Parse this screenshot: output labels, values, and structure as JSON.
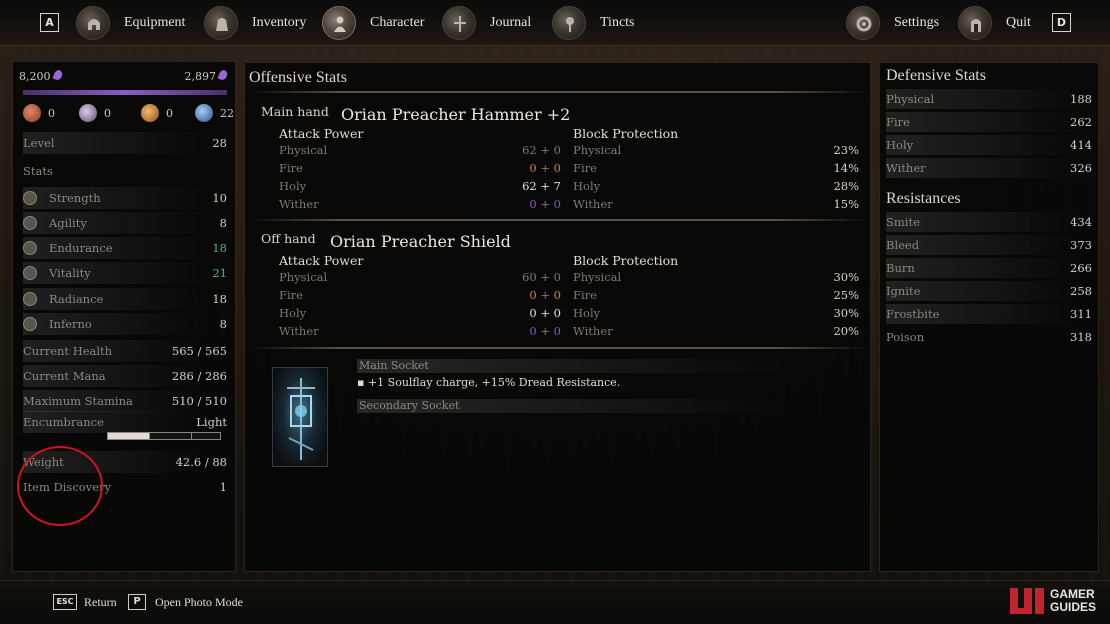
{
  "top_nav": {
    "left_key": "A",
    "right_key": "D",
    "items": [
      {
        "label": "Equipment",
        "icon": "helmet-icon"
      },
      {
        "label": "Inventory",
        "icon": "bag-icon"
      },
      {
        "label": "Character",
        "icon": "character-icon"
      },
      {
        "label": "Journal",
        "icon": "journal-icon"
      },
      {
        "label": "Tincts",
        "icon": "tincts-icon"
      }
    ],
    "settings_label": "Settings",
    "quit_label": "Quit",
    "active": "Character"
  },
  "character": {
    "souls_held": "8,200",
    "souls_needed": "2,897",
    "resources": [
      {
        "icon": "hand-icon",
        "value": "0",
        "color": "#b5533a"
      },
      {
        "icon": "orb-icon",
        "value": "0",
        "color": "#8f7fa6"
      },
      {
        "icon": "amber-icon",
        "value": "0",
        "color": "#b9762f"
      },
      {
        "icon": "crystal-icon",
        "value": "22",
        "color": "#3d6fa8"
      }
    ],
    "level_label": "Level",
    "level_value": "28",
    "stats_heading": "Stats",
    "stats": [
      {
        "label": "Strength",
        "value": "10",
        "highlight": false
      },
      {
        "label": "Agility",
        "value": "8",
        "highlight": false
      },
      {
        "label": "Endurance",
        "value": "18",
        "highlight": true
      },
      {
        "label": "Vitality",
        "value": "21",
        "highlight": true
      },
      {
        "label": "Radiance",
        "value": "18",
        "highlight": false
      },
      {
        "label": "Inferno",
        "value": "8",
        "highlight": false
      }
    ],
    "current_health_label": "Current Health",
    "current_health_value": "565 / 565",
    "current_mana_label": "Current Mana",
    "current_mana_value": "286 / 286",
    "max_stamina_label": "Maximum Stamina",
    "max_stamina_value": "510 / 510",
    "encumbrance_label": "Encumbrance",
    "encumbrance_value": "Light",
    "encumbrance_fill": 0.37,
    "weight_label": "Weight",
    "weight_value": "42.6 / 88",
    "item_discovery_label": "Item Discovery",
    "item_discovery_value": "1"
  },
  "offensive": {
    "title": "Offensive Stats",
    "main_hand": {
      "label": "Main hand",
      "name": "Orian Preacher Hammer +2",
      "attack_title": "Attack Power",
      "block_title": "Block Protection",
      "attack": [
        {
          "name": "Physical",
          "base": "62",
          "bonus": "0",
          "kind": "gray"
        },
        {
          "name": "Fire",
          "base": "0",
          "bonus": "0",
          "kind": "fire"
        },
        {
          "name": "Holy",
          "base": "62",
          "bonus": "7",
          "kind": "holy"
        },
        {
          "name": "Wither",
          "base": "0",
          "bonus": "0",
          "kind": "wither"
        }
      ],
      "block": [
        {
          "name": "Physical",
          "value": "23%"
        },
        {
          "name": "Fire",
          "value": "14%"
        },
        {
          "name": "Holy",
          "value": "28%"
        },
        {
          "name": "Wither",
          "value": "15%"
        }
      ]
    },
    "off_hand": {
      "label": "Off hand",
      "name": "Orian Preacher Shield",
      "attack_title": "Attack Power",
      "block_title": "Block Protection",
      "attack": [
        {
          "name": "Physical",
          "base": "60",
          "bonus": "0",
          "kind": "gray"
        },
        {
          "name": "Fire",
          "base": "0",
          "bonus": "0",
          "kind": "fire"
        },
        {
          "name": "Holy",
          "base": "0",
          "bonus": "0",
          "kind": "holy"
        },
        {
          "name": "Wither",
          "base": "0",
          "bonus": "0",
          "kind": "wither"
        }
      ],
      "block": [
        {
          "name": "Physical",
          "value": "30%"
        },
        {
          "name": "Fire",
          "value": "25%"
        },
        {
          "name": "Holy",
          "value": "30%"
        },
        {
          "name": "Wither",
          "value": "20%"
        }
      ]
    },
    "sockets": {
      "main_label": "Main Socket",
      "main_text": "▪ +1 Soulflay charge, +15% Dread Resistance.",
      "secondary_label": "Secondary Socket"
    }
  },
  "defensive": {
    "title": "Defensive Stats",
    "rows": [
      {
        "label": "Physical",
        "value": "188"
      },
      {
        "label": "Fire",
        "value": "262"
      },
      {
        "label": "Holy",
        "value": "414"
      },
      {
        "label": "Wither",
        "value": "326"
      }
    ]
  },
  "resistances": {
    "title": "Resistances",
    "rows": [
      {
        "label": "Smite",
        "value": "434"
      },
      {
        "label": "Bleed",
        "value": "373"
      },
      {
        "label": "Burn",
        "value": "266"
      },
      {
        "label": "Ignite",
        "value": "258"
      },
      {
        "label": "Frostbite",
        "value": "311"
      },
      {
        "label": "Poison",
        "value": "318"
      }
    ]
  },
  "footer": {
    "return_key": "ESC",
    "return_label": "Return",
    "photo_key": "P",
    "photo_label": "Open Photo Mode",
    "brand_line1": "GAMER",
    "brand_line2": "GUIDES"
  }
}
